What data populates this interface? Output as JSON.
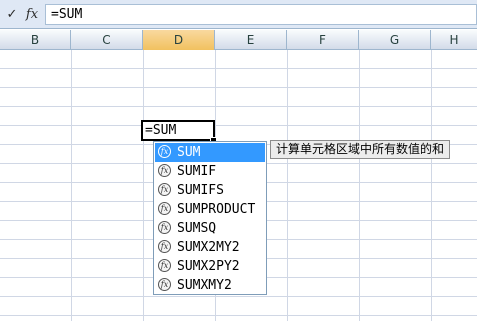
{
  "formula_bar": {
    "check_glyph": "✓",
    "fx_glyph": "fx",
    "formula_text": "=SUM"
  },
  "columns": [
    "B",
    "C",
    "D",
    "E",
    "F",
    "G",
    "H"
  ],
  "selected_column": "D",
  "active_cell": {
    "content": "=SUM"
  },
  "autocomplete": {
    "items": [
      "SUM",
      "SUMIF",
      "SUMIFS",
      "SUMPRODUCT",
      "SUMSQ",
      "SUMX2MY2",
      "SUMX2PY2",
      "SUMXMY2"
    ],
    "selected": "SUM",
    "icon_glyph": "fx"
  },
  "tooltip": {
    "text": "计算单元格区域中所有数值的和"
  },
  "colors": {
    "selected_item": "#3399ff",
    "header_selected": "#f1c15f",
    "grid_line": "#d0d7e5"
  }
}
